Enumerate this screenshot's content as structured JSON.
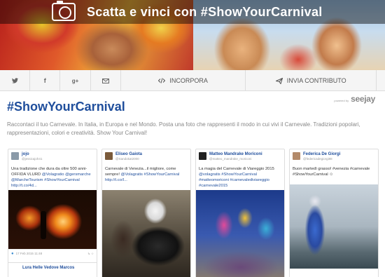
{
  "banner": {
    "title": "Scatta e vinci con #ShowYourCarnival"
  },
  "toolbar": {
    "embed_label": "INCORPORA",
    "send_label": "INVIA CONTRIBUTO",
    "powered_small": "powered by",
    "powered_logo": "seejay"
  },
  "main": {
    "hashtag": "#ShowYourCarnival",
    "description": "Raccontaci il tuo Carnevale. In Italia, in Europa e nel Mondo. Posta una foto che rappresenti il modo in cui vivi il Carnevale. Tradizioni popolari, rappresentazioni, colori e creatività. Show Your Carnival!"
  },
  "cards": [
    {
      "name": "jojo",
      "handle": "@jessicajoh41",
      "text_main": "Una tradizione che dura da oltre 500 anni- OFFIDA VLURD ",
      "text_links": "@Volagratio @gersmarche @MarcheTourism #ShowYourCarnival http://t.co/4d...",
      "date": "17 Feb 2015 11:48",
      "share": "↳ ☆"
    },
    {
      "name": "Eliseo Gaiota",
      "handle": "@Sandokat2000",
      "text_main": "Carnevale di Venezia...il migliore, come sempre! ",
      "text_links": "@Volagratis #ShowYourCarnival http://t.co/I..."
    },
    {
      "name": "Matteo Mandrake Moriconi",
      "handle": "@matteo_mandrake_moriconi",
      "text_main": "La magia del Carnevale di Viareggio 2015 ",
      "text_links": "@volagratis #ShowYourCarnival #matteomoriconi #carnevalediviareggio #carnevale2015"
    },
    {
      "name": "Federica De Giorgi",
      "handle": "@federicadegiorgi88",
      "text_main": "Buon martedì grasso! #venezia #carnevale #ShowYourCarnival ☺",
      "text_links": ""
    }
  ],
  "second_row": {
    "name": "Lura Helle Vedove Marcos"
  },
  "colors": {
    "accent": "#1f4e9c",
    "twitter": "#3a8bd0"
  },
  "icons": [
    "camera-icon",
    "twitter-icon",
    "facebook-icon",
    "google-plus-icon",
    "email-icon",
    "code-icon",
    "send-icon"
  ]
}
